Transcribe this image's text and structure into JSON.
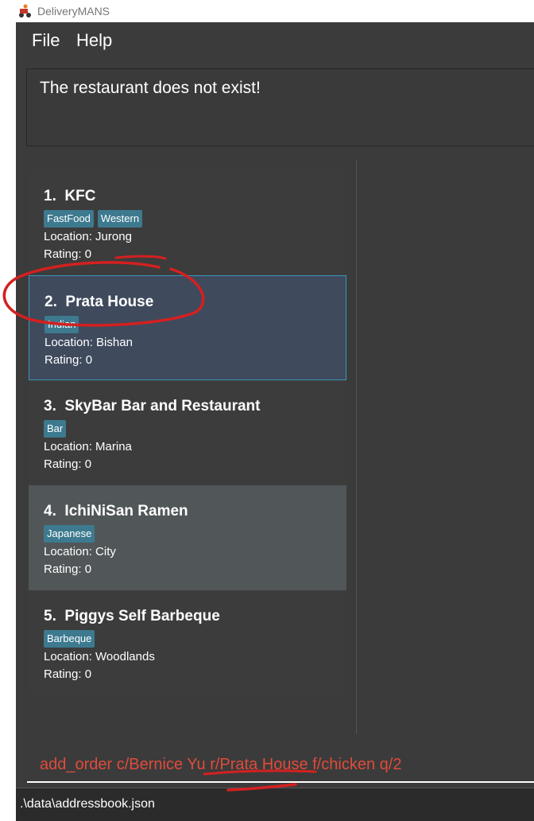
{
  "window": {
    "title": "DeliveryMANS",
    "icon": "delivery-scooter-icon"
  },
  "menu": {
    "items": [
      "File",
      "Help"
    ]
  },
  "result": {
    "message": "The restaurant does not exist!"
  },
  "restaurants": [
    {
      "index": "1.",
      "name": "KFC",
      "tags": [
        "FastFood",
        "Western"
      ],
      "location": "Location: Jurong",
      "rating": "Rating: 0"
    },
    {
      "index": "2.",
      "name": "Prata House",
      "tags": [
        "Indian"
      ],
      "location": "Location: Bishan",
      "rating": "Rating: 0"
    },
    {
      "index": "3.",
      "name": "SkyBar Bar and Restaurant",
      "tags": [
        "Bar"
      ],
      "location": "Location: Marina",
      "rating": "Rating: 0"
    },
    {
      "index": "4.",
      "name": "IchiNiSan Ramen",
      "tags": [
        "Japanese"
      ],
      "location": "Location: City",
      "rating": "Rating: 0"
    },
    {
      "index": "5.",
      "name": "Piggys Self Barbeque",
      "tags": [
        "Barbeque"
      ],
      "location": "Location: Woodlands",
      "rating": "Rating: 0"
    }
  ],
  "command": {
    "value": "add_order c/Bernice Yu r/Prata House f/chicken q/2"
  },
  "status": {
    "path": ".\\data\\addressbook.json"
  },
  "colors": {
    "background": "#3b3b3b",
    "selected": "#3f4a5d",
    "tag": "#3d7a8f",
    "error_text": "#e04b3b",
    "annotation": "#d42020"
  }
}
